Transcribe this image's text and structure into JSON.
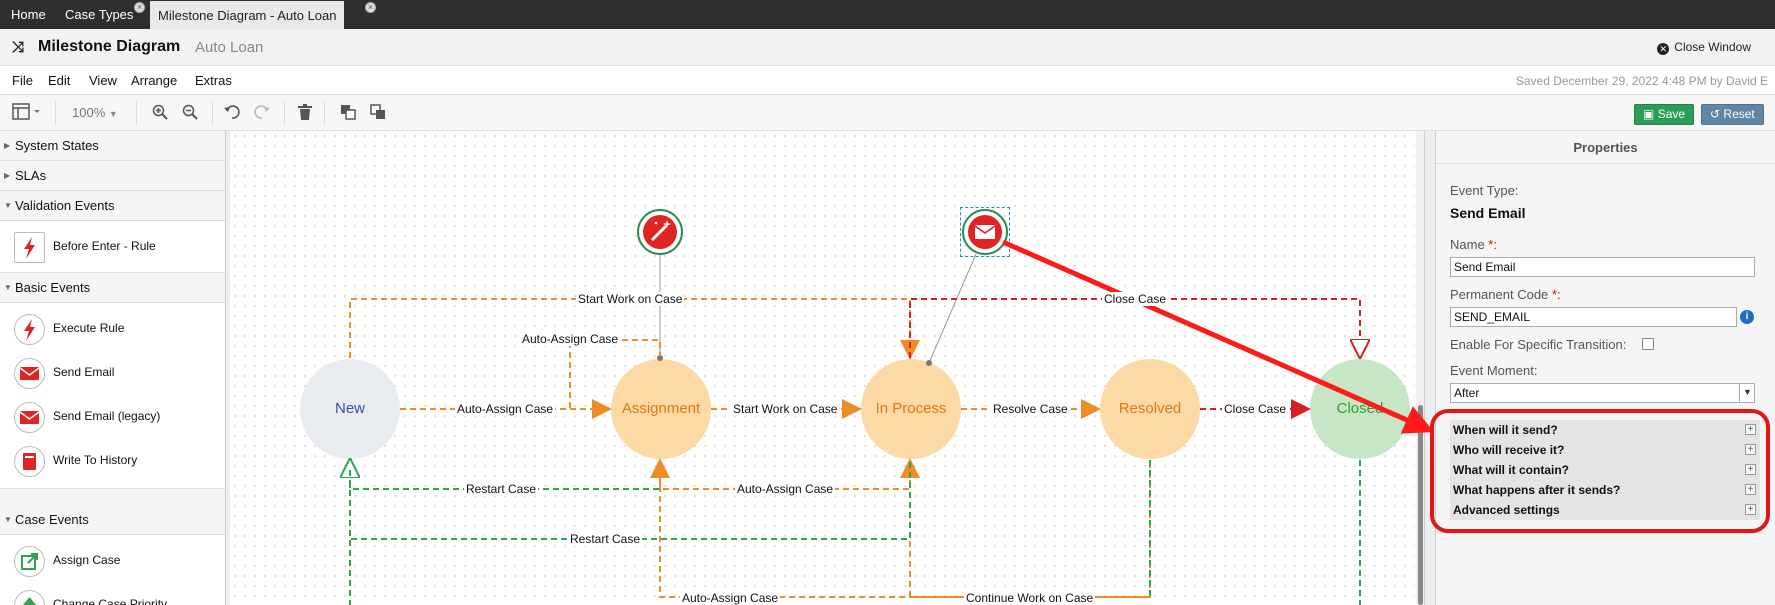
{
  "tabs": [
    {
      "label": "Home"
    },
    {
      "label": "Case Types"
    },
    {
      "label": "Milestone Diagram - Auto Loan"
    }
  ],
  "tab_close_glyph": "×",
  "header": {
    "title": "Milestone Diagram",
    "subtitle": "Auto Loan",
    "close_label": "Close Window"
  },
  "menu": [
    "File",
    "Edit",
    "View",
    "Arrange",
    "Extras"
  ],
  "saved_text": "Saved December 29, 2022 4:48 PM by David E",
  "toolbar": {
    "zoom": "100%",
    "save_label": "Save",
    "reset_label": "Reset"
  },
  "palette": {
    "system_states": "System States",
    "slas": "SLAs",
    "validation_events": "Validation Events",
    "before_enter": "Before Enter - Rule",
    "basic_events": "Basic Events",
    "execute_rule": "Execute Rule",
    "send_email": "Send Email",
    "send_email_legacy": "Send Email (legacy)",
    "write_history": "Write To History",
    "case_events": "Case Events",
    "assign_case": "Assign Case",
    "change_priority": "Change Case Priority"
  },
  "diagram": {
    "states": {
      "new": "New",
      "assignment": "Assignment",
      "in_process": "In Process",
      "resolved": "Resolved",
      "closed": "Closed"
    },
    "edges": {
      "start_work_top": "Start Work on Case",
      "close_case_top": "Close Case",
      "auto_assign_up": "Auto-Assign Case",
      "new_to_assign": "Auto-Assign Case",
      "assign_to_proc": "Start Work on Case",
      "proc_to_resolved": "Resolve Case",
      "resolved_to_closed": "Close Case",
      "restart_1": "Restart Case",
      "auto_assign_mid": "Auto-Assign Case",
      "restart_2": "Restart Case",
      "auto_assign_bottom": "Auto-Assign Case",
      "continue_work": "Continue Work on Case"
    }
  },
  "properties": {
    "title": "Properties",
    "event_type_label": "Event Type:",
    "event_type_value": "Send Email",
    "name_label": "Name ",
    "required_mark": "*:",
    "name_value": "Send Email",
    "perm_code_label": "Permanent Code ",
    "perm_code_value": "SEND_EMAIL",
    "info_glyph": "i",
    "specific_transition_label": "Enable For Specific Transition:",
    "event_moment_label": "Event Moment:",
    "event_moment_value": "After",
    "sections": [
      {
        "label": "When will it send?"
      },
      {
        "label": "Who will receive it?"
      },
      {
        "label": "What will it contain?"
      },
      {
        "label": "What happens after it sends?"
      },
      {
        "label": "Advanced settings"
      }
    ]
  },
  "colors": {
    "orange_edge": "#f08c28",
    "red_edge": "#d42020",
    "green_edge": "#2ea44f",
    "assignment_fill": "#fdd9a6",
    "closed_fill": "#c7e6c5",
    "new_fill": "#e8ecf1",
    "annotation_red": "#e41515"
  }
}
